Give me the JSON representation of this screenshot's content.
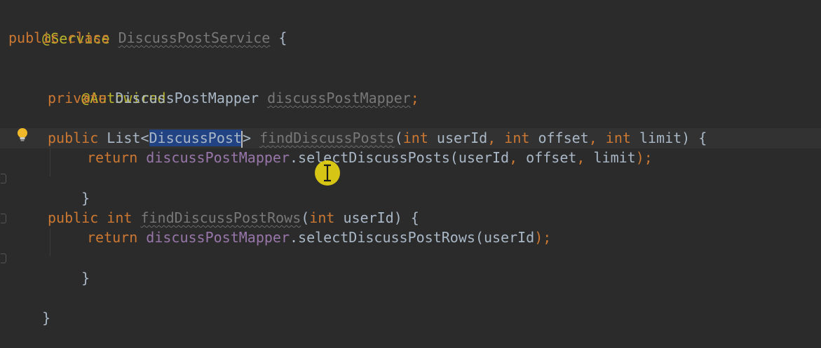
{
  "code": {
    "l1": "@Service",
    "l2_kw1": "public",
    "l2_kw2": "class",
    "l2_name": "DiscussPostService",
    "l2_brace": " {",
    "l4": "@Autowired",
    "l5_kw": "private",
    "l5_type": "DiscussPostMapper",
    "l5_field": "discussPostMapper",
    "l5_semi": ";",
    "l7_kw": "public",
    "l7_type_a": "List<",
    "l7_type_sel": "DiscussPost",
    "l7_type_b": ">",
    "l7_method": "findDiscussPosts",
    "l7_open": "(",
    "l7_int1": "int",
    "l7_p1": " userId",
    "l7_comma1": ", ",
    "l7_int2": "int",
    "l7_p2": " offset",
    "l7_comma2": ", ",
    "l7_int3": "int",
    "l7_p3": " limit",
    "l7_close": ") {",
    "l8_kw": "return",
    "l8_field": "discussPostMapper",
    "l8_call": ".selectDiscussPosts(userId",
    "l8_c1": ", ",
    "l8_a2": "offset",
    "l8_c2": ", ",
    "l8_a3": "limit",
    "l8_end": ");",
    "l9": "}",
    "l11_kw1": "public",
    "l11_kw2": "int",
    "l11_method": "findDiscussPostRows",
    "l11_open": "(",
    "l11_int": "int",
    "l11_p": " userId",
    "l11_close": ") {",
    "l12_kw": "return",
    "l12_field": "discussPostMapper",
    "l12_call": ".selectDiscussPostRows(userId",
    "l12_end": ");",
    "l13": "}",
    "l15": "}"
  },
  "colors": {
    "background": "#2b2b2b",
    "keyword": "#cc7832",
    "annotation": "#bbb529",
    "field": "#9876aa",
    "text": "#a9b7c6",
    "selection": "#214283",
    "cursor_highlight": "#e6d213"
  },
  "icons": {
    "intention": "lightbulb-icon",
    "mouse": "i-beam-cursor-icon",
    "gutter": "fold-marker-icon"
  }
}
